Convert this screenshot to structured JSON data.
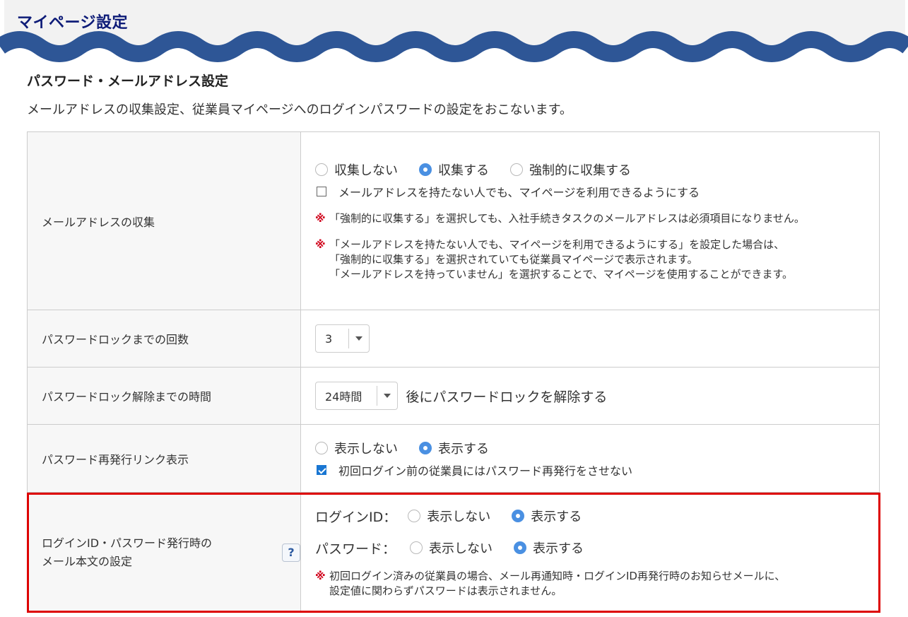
{
  "header": {
    "title": "マイページ設定"
  },
  "section": {
    "title": "パスワード・メールアドレス設定",
    "description": "メールアドレスの収集設定、従業員マイページへのログインパスワードの設定をおこないます。"
  },
  "rows": {
    "collect": {
      "label": "メールアドレスの収集",
      "options": [
        "収集しない",
        "収集する",
        "強制的に収集する"
      ],
      "selected": "収集する",
      "checkbox_label": "メールアドレスを持たない人でも、マイページを利用できるようにする",
      "checkbox_checked": false,
      "note_mark": "※",
      "note1": "「強制的に収集する」を選択しても、入社手続きタスクのメールアドレスは必須項目になりません。",
      "note2_line1": "「メールアドレスを持たない人でも、マイページを利用できるようにする」を設定した場合は、",
      "note2_line2": "「強制的に収集する」を選択されていても従業員マイページで表示されます。",
      "note2_line3": "「メールアドレスを持っていません」を選択することで、マイページを使用することができます。"
    },
    "lock_count": {
      "label": "パスワードロックまでの回数",
      "value": "3"
    },
    "lock_time": {
      "label": "パスワードロック解除までの時間",
      "value": "24時間",
      "suffix": "後にパスワードロックを解除する"
    },
    "reissue": {
      "label": "パスワード再発行リンク表示",
      "options": [
        "表示しない",
        "表示する"
      ],
      "selected": "表示する",
      "checkbox_label": "初回ログイン前の従業員にはパスワード再発行をさせない",
      "checkbox_checked": true
    },
    "login_mail": {
      "label_line1": "ログインID・パスワード発行時の",
      "label_line2": "メール本文の設定",
      "help": "?",
      "login_id_label": "ログインID：",
      "password_label": "パスワード：",
      "options": [
        "表示しない",
        "表示する"
      ],
      "login_id_selected": "表示する",
      "password_selected": "表示する",
      "note_mark": "※",
      "note_line1": "初回ログイン済みの従業員の場合、メール再通知時・ログインID再発行時のお知らせメールに、",
      "note_line2": "設定値に関わらずパスワードは表示されません。"
    }
  },
  "colors": {
    "title": "#0e1c78",
    "wave": "#2e5696",
    "radio_selected": "#4a90e2",
    "checkbox_checked": "#1976d2",
    "note_mark": "#d0021b",
    "highlight_border": "#dd0000"
  }
}
